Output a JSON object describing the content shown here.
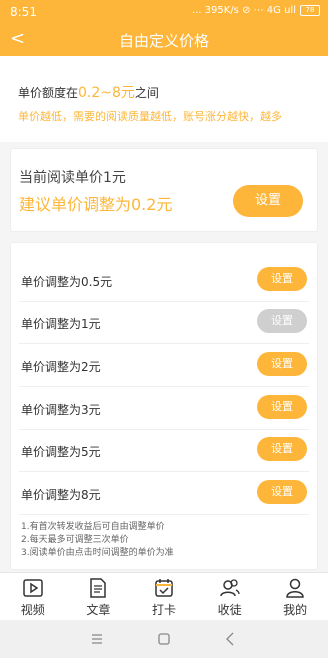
{
  "status": {
    "time": "8:51",
    "net": "... 395K/s ⊘ ⋯ 4G ull",
    "battery": "78"
  },
  "header": {
    "back": "<",
    "title": "自由定义价格"
  },
  "intro": {
    "prefix": "单价额度在",
    "range": "0.2~8元",
    "suffix": "之间",
    "desc": "单价越低，需要的阅读质量越低，账号涨分越快，越多"
  },
  "current": {
    "price": "当前阅读单价1元",
    "suggest": "建议单价调整为0.2元",
    "button": "设置"
  },
  "options": [
    {
      "label": "单价调整为0.5元",
      "button": "设置",
      "enabled": true
    },
    {
      "label": "单价调整为1元",
      "button": "设置",
      "enabled": false
    },
    {
      "label": "单价调整为2元",
      "button": "设置",
      "enabled": true
    },
    {
      "label": "单价调整为3元",
      "button": "设置",
      "enabled": true
    },
    {
      "label": "单价调整为5元",
      "button": "设置",
      "enabled": true
    },
    {
      "label": "单价调整为8元",
      "button": "设置",
      "enabled": true
    }
  ],
  "notes": [
    "1.有首次转发收益后可自由调整单价",
    "2.每天最多可调整三次单价",
    "3.阅读单价由点击时间调整的单价为准"
  ],
  "tabs": [
    {
      "label": "视频",
      "icon": "video-icon"
    },
    {
      "label": "文章",
      "icon": "article-icon"
    },
    {
      "label": "打卡",
      "icon": "checkin-icon"
    },
    {
      "label": "收徒",
      "icon": "apprentice-icon"
    },
    {
      "label": "我的",
      "icon": "profile-icon"
    }
  ],
  "colors": {
    "accent": "#fdb63a",
    "disabled": "#cfcfcf"
  }
}
